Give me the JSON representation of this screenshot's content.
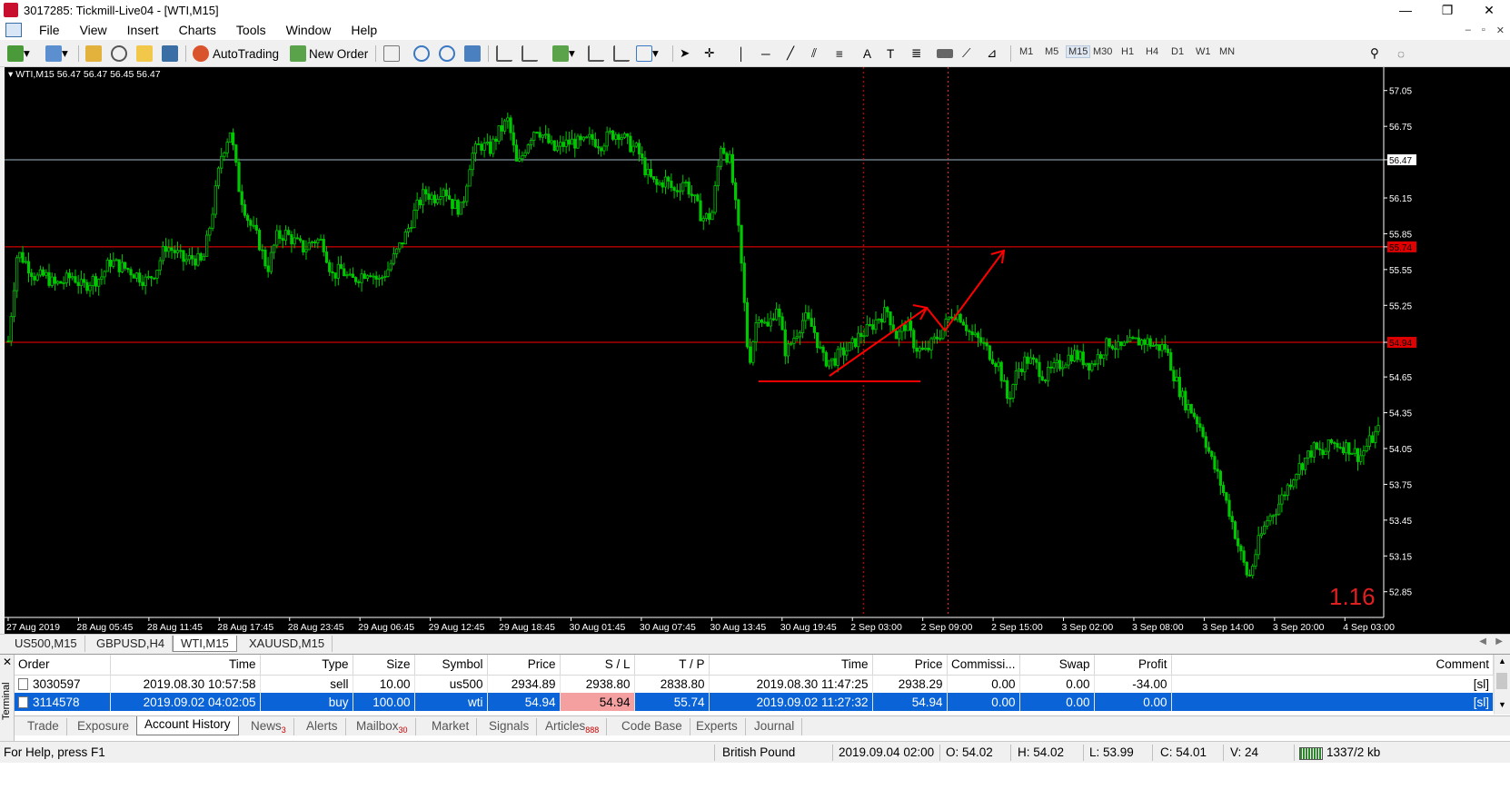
{
  "window": {
    "title": "3017285: Tickmill-Live04 - [WTI,M15]",
    "controls": [
      "—",
      "❐",
      "✕"
    ]
  },
  "menu": [
    "File",
    "View",
    "Insert",
    "Charts",
    "Tools",
    "Window",
    "Help"
  ],
  "toolbar": {
    "autotrading": "AutoTrading",
    "new_order": "New Order",
    "timeframes": [
      "M1",
      "M5",
      "M15",
      "M30",
      "H1",
      "H4",
      "D1",
      "W1",
      "MN"
    ],
    "active_timeframe": "M15"
  },
  "chart": {
    "info": "WTI,M15  56.47 56.47 56.45 56.47",
    "price_labels": [
      "57.05",
      "56.75",
      "56.47",
      "56.15",
      "55.85",
      "55.74",
      "55.55",
      "55.25",
      "54.94",
      "54.65",
      "54.35",
      "54.05",
      "53.75",
      "53.45",
      "53.15",
      "52.85"
    ],
    "time_labels": [
      "27 Aug 2019",
      "28 Aug 05:45",
      "28 Aug 11:45",
      "28 Aug 17:45",
      "28 Aug 23:45",
      "29 Aug 06:45",
      "29 Aug 12:45",
      "29 Aug 18:45",
      "30 Aug 01:45",
      "30 Aug 07:45",
      "30 Aug 13:45",
      "30 Aug 19:45",
      "2 Sep 03:00",
      "2 Sep 09:00",
      "2 Sep 15:00",
      "3 Sep 02:00",
      "3 Sep 08:00",
      "3 Sep 14:00",
      "3 Sep 20:00",
      "4 Sep 03:00"
    ],
    "current_price": "56.47",
    "tp_level": "55.74",
    "sl_level": "54.94",
    "overlay_value": "1.16",
    "colors": {
      "bg": "#000000",
      "candle": "#00c800",
      "level": "#ff0000",
      "bid": "#9fb8c8",
      "axis_text": "#ffffff"
    },
    "price_series": [
      54.95,
      55.7,
      55.6,
      55.48,
      55.5,
      55.42,
      55.45,
      55.5,
      55.4,
      55.46,
      55.48,
      55.62,
      55.58,
      55.55,
      55.5,
      55.45,
      55.55,
      55.75,
      55.7,
      55.62,
      55.65,
      55.6,
      56.0,
      56.5,
      56.72,
      56.2,
      55.95,
      55.8,
      55.55,
      55.82,
      55.85,
      55.78,
      55.72,
      55.8,
      55.78,
      55.5,
      55.55,
      55.45,
      55.5,
      55.55,
      55.45,
      55.55,
      55.7,
      55.85,
      56.05,
      56.2,
      56.15,
      56.25,
      56.1,
      56.05,
      56.5,
      56.6,
      56.55,
      56.7,
      56.8,
      56.4,
      56.6,
      56.75,
      56.65,
      56.55,
      56.6,
      56.62,
      56.6,
      56.65,
      56.6,
      56.68,
      56.7,
      56.6,
      56.55,
      56.35,
      56.25,
      56.3,
      56.2,
      56.3,
      56.15,
      55.98,
      56.0,
      56.6,
      56.45,
      55.8,
      54.75,
      55.2,
      55.05,
      55.25,
      54.85,
      55.0,
      55.15,
      55.05,
      54.8,
      54.78,
      54.85,
      54.9,
      55.0,
      55.05,
      55.15,
      55.2,
      54.98,
      55.1,
      54.9,
      54.85,
      54.95,
      55.05,
      55.2,
      55.15,
      55.0,
      54.95,
      54.85,
      54.75,
      54.45,
      54.7,
      54.8,
      54.75,
      54.65,
      54.72,
      54.78,
      54.85,
      54.8,
      54.75,
      54.85,
      54.95,
      54.88,
      54.92,
      54.95,
      54.95,
      54.9,
      54.9,
      54.65,
      54.45,
      54.35,
      54.2,
      53.95,
      53.75,
      53.5,
      53.2,
      52.95,
      53.25,
      53.45,
      53.55,
      53.7,
      53.85,
      53.95,
      54.05,
      54.0,
      54.1,
      54.08,
      54.05,
      53.98,
      54.1,
      54.2
    ]
  },
  "symbol_tabs": [
    "US500,M15",
    "GBPUSD,H4",
    "WTI,M15",
    "XAUUSD,M15"
  ],
  "active_symbol_tab": "WTI,M15",
  "history": {
    "columns": [
      "Order",
      "Time",
      "Type",
      "Size",
      "Symbol",
      "Price",
      "S / L",
      "T / P",
      "Time",
      "Price",
      "Commissi...",
      "Swap",
      "Profit",
      "Comment"
    ],
    "rows": [
      [
        "3030597",
        "2019.08.30 10:57:58",
        "sell",
        "10.00",
        "us500",
        "2934.89",
        "2938.80",
        "2838.80",
        "2019.08.30 11:47:25",
        "2938.29",
        "0.00",
        "0.00",
        "-34.00",
        "[sl]"
      ],
      [
        "3114578",
        "2019.09.02 04:02:05",
        "buy",
        "100.00",
        "wti",
        "54.94",
        "54.94",
        "55.74",
        "2019.09.02 11:27:32",
        "54.94",
        "0.00",
        "0.00",
        "0.00",
        "[sl]"
      ]
    ],
    "selected_row": 1
  },
  "terminal_label": "Terminal",
  "bottom_tabs": [
    {
      "label": "Trade",
      "badge": ""
    },
    {
      "label": "Exposure",
      "badge": ""
    },
    {
      "label": "Account History",
      "badge": ""
    },
    {
      "label": "News",
      "badge": "3"
    },
    {
      "label": "Alerts",
      "badge": ""
    },
    {
      "label": "Mailbox",
      "badge": "30"
    },
    {
      "label": "Market",
      "badge": ""
    },
    {
      "label": "Signals",
      "badge": ""
    },
    {
      "label": "Articles",
      "badge": "888"
    },
    {
      "label": "Code Base",
      "badge": ""
    },
    {
      "label": "Experts",
      "badge": ""
    },
    {
      "label": "Journal",
      "badge": ""
    }
  ],
  "active_bottom_tab": "Account History",
  "status": {
    "help": "For Help, press F1",
    "profile": "British Pound",
    "datetime": "2019.09.04 02:00",
    "open": "O: 54.02",
    "high": "H: 54.02",
    "low": "L: 53.99",
    "close": "C: 54.01",
    "volume": "V: 24",
    "traffic": "1337/2 kb"
  }
}
